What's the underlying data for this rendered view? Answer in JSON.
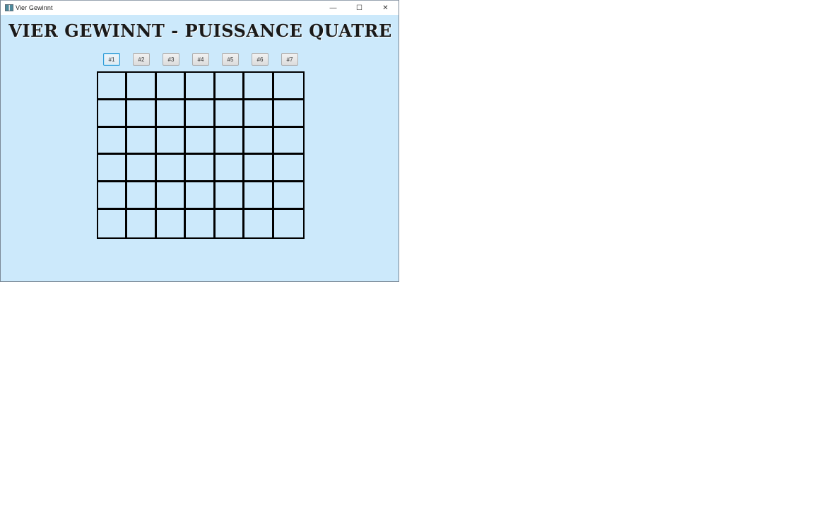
{
  "window": {
    "title": "Vier Gewinnt",
    "icon": "app-window-icon",
    "controls": {
      "minimize": "—",
      "maximize": "☐",
      "close": "✕"
    }
  },
  "game": {
    "heading": "VIER GEWINNT - PUISSANCE QUATRE",
    "column_buttons": [
      "#1",
      "#2",
      "#3",
      "#4",
      "#5",
      "#6",
      "#7"
    ],
    "focused_button": 0,
    "board": {
      "rows": 6,
      "columns": 7
    }
  },
  "colors": {
    "background": "#cce9fb",
    "grid": "#000000",
    "focus": "#2e9cd8"
  }
}
